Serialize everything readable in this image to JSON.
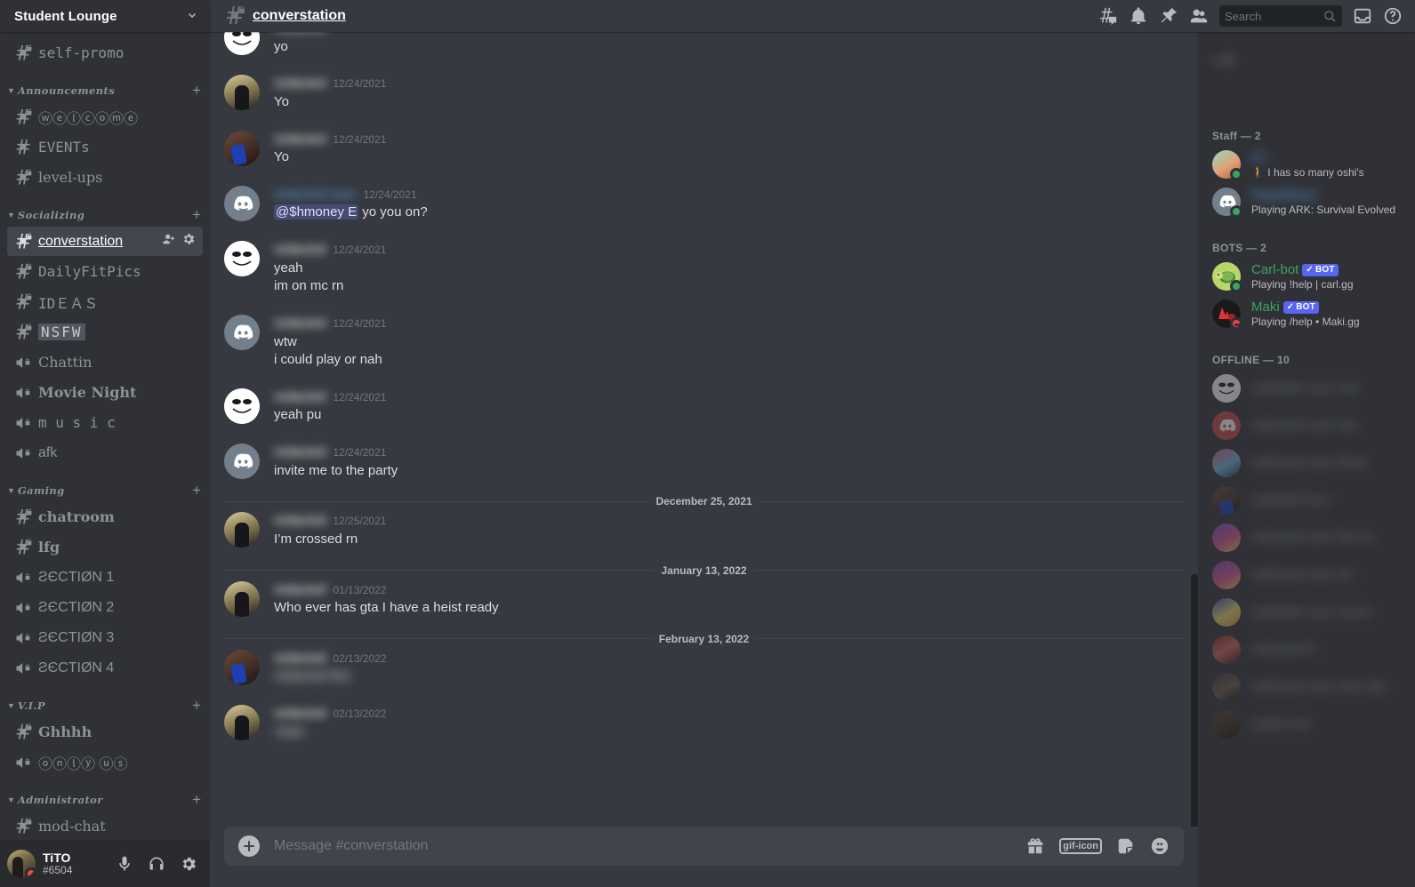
{
  "server": {
    "name": "Student Lounge",
    "chevron": "⌄"
  },
  "sidebar": {
    "top_channel": {
      "label": "self-promo",
      "icon": "hash-lock-icon"
    },
    "categories": [
      {
        "name": "Announcements",
        "channels": [
          {
            "label": "ⓦⓔⓛⓒⓞⓜⓔ",
            "type": "text",
            "locked": true,
            "style": "circled"
          },
          {
            "label": "EVENTs",
            "type": "text",
            "locked": false,
            "style": "plain"
          },
          {
            "label": "level-ups",
            "type": "text",
            "locked": true,
            "style": "serif"
          }
        ]
      },
      {
        "name": "Socializing",
        "channels": [
          {
            "label": "converstation",
            "type": "text",
            "locked": true,
            "style": "plain",
            "active": true
          },
          {
            "label": "DailyFitPics",
            "type": "text",
            "locked": true,
            "style": "mono"
          },
          {
            "label": "IDＥＡＳ",
            "type": "text",
            "locked": true,
            "style": "mono"
          },
          {
            "label": "NSFW",
            "type": "text",
            "locked": true,
            "style": "boxed"
          },
          {
            "label": "Chattin",
            "type": "voice",
            "locked": true,
            "style": "serif"
          },
          {
            "label": "Movie Night",
            "type": "voice",
            "locked": true,
            "style": "gothic"
          },
          {
            "label": "m u s i c",
            "type": "voice",
            "locked": true,
            "style": "mono"
          },
          {
            "label": "afk",
            "type": "voice",
            "locked": true,
            "style": "plain"
          }
        ]
      },
      {
        "name": "Gaming",
        "channels": [
          {
            "label": "chatroom",
            "type": "text",
            "locked": true,
            "style": "gothic"
          },
          {
            "label": "lfg",
            "type": "text",
            "locked": true,
            "style": "gothic"
          },
          {
            "label": "ƧЄCTIØN 1",
            "type": "voice",
            "locked": true,
            "style": "plain"
          },
          {
            "label": "ƧЄCTIØN 2",
            "type": "voice",
            "locked": true,
            "style": "plain"
          },
          {
            "label": "ƧЄCTIØN 3",
            "type": "voice",
            "locked": true,
            "style": "plain"
          },
          {
            "label": "ƧЄCTIØN 4",
            "type": "voice",
            "locked": true,
            "style": "plain"
          }
        ]
      },
      {
        "name": "V.I.P",
        "channels": [
          {
            "label": "Ghhhh",
            "type": "text",
            "locked": true,
            "style": "gothic"
          },
          {
            "label": "ⓞⓝⓛⓨ ⓤⓢ",
            "type": "voice",
            "locked": true,
            "style": "circled"
          }
        ]
      },
      {
        "name": "Administrator",
        "channels": [
          {
            "label": "mod-chat",
            "type": "text",
            "locked": true,
            "style": "serif"
          }
        ]
      }
    ]
  },
  "user_panel": {
    "username": "TiTO",
    "discriminator": "#6504",
    "status": "dnd",
    "icons": [
      "microphone-icon",
      "headphones-icon",
      "gear-icon"
    ]
  },
  "topbar": {
    "channel": "converstation",
    "icons": [
      "threads-icon",
      "bell-icon",
      "pin-icon",
      "members-icon",
      "inbox-icon",
      "help-icon"
    ]
  },
  "search": {
    "placeholder": "Search",
    "value": ""
  },
  "messages": [
    {
      "id": 1,
      "author": "redacted",
      "author_blurred": true,
      "timestamp": "",
      "avatar": "av-meme",
      "lines": [
        {
          "text": "yo"
        }
      ],
      "partial_top": true
    },
    {
      "id": 2,
      "author": "redacted",
      "author_blurred": true,
      "timestamp": "12/24/2021",
      "avatar": "av-suit",
      "lines": [
        {
          "text": "Yo"
        }
      ]
    },
    {
      "id": 3,
      "author": "redacted",
      "author_blurred": true,
      "timestamp": "12/24/2021",
      "avatar": "av-phone",
      "lines": [
        {
          "text": "Yo"
        }
      ]
    },
    {
      "id": 4,
      "author": "redacted-ryan",
      "author_blurred": true,
      "author_color": "blue",
      "timestamp": "12/24/2021",
      "avatar": "av-discord-grey",
      "lines": [
        {
          "mention": "@$hmoney E",
          "text": " yo you on?"
        }
      ]
    },
    {
      "id": 5,
      "author": "redacted",
      "author_blurred": true,
      "timestamp": "12/24/2021",
      "avatar": "av-meme",
      "lines": [
        {
          "text": "yeah"
        },
        {
          "text": "im on mc rn"
        }
      ]
    },
    {
      "id": 6,
      "author": "redacted",
      "author_blurred": true,
      "timestamp": "12/24/2021",
      "avatar": "av-discord-grey",
      "lines": [
        {
          "text": "wtw"
        },
        {
          "text": "i could play or nah"
        }
      ]
    },
    {
      "id": 7,
      "author": "redacted",
      "author_blurred": true,
      "timestamp": "12/24/2021",
      "avatar": "av-meme",
      "lines": [
        {
          "text": "yeah pu"
        }
      ]
    },
    {
      "id": 8,
      "author": "redacted",
      "author_blurred": true,
      "timestamp": "12/24/2021",
      "avatar": "av-discord-grey",
      "lines": [
        {
          "text": "invite me to the party"
        }
      ]
    }
  ],
  "dividers": {
    "dec25": "December 25, 2021",
    "jan13": "January 13, 2022",
    "feb13": "February 13, 2022"
  },
  "messages2": [
    {
      "id": 9,
      "author": "redacted",
      "author_blurred": true,
      "timestamp": "12/25/2021",
      "avatar": "av-suit",
      "lines": [
        {
          "text": "I’m crossed rn"
        }
      ]
    }
  ],
  "messages3": [
    {
      "id": 10,
      "author": "redacted",
      "author_blurred": true,
      "timestamp": "01/13/2022",
      "avatar": "av-suit",
      "lines": [
        {
          "text": "Who ever has gta I have a heist ready"
        }
      ]
    }
  ],
  "messages4": [
    {
      "id": 11,
      "author": "redacted",
      "author_blurred": true,
      "timestamp": "02/13/2022",
      "avatar": "av-phone",
      "lines": [
        {
          "text": "redacted this",
          "blurred": true
        }
      ]
    },
    {
      "id": 12,
      "author": "redacted",
      "author_blurred": true,
      "timestamp": "02/13/2022",
      "avatar": "av-suit",
      "lines": [
        {
          "text": "Yeah",
          "blurred": true
        }
      ]
    }
  ],
  "composer": {
    "placeholder": "Message #converstation",
    "value": "",
    "icons": [
      "gift-icon",
      "gif-icon",
      "sticker-icon",
      "emoji-icon"
    ]
  },
  "members": {
    "groups": [
      {
        "label": "— 1",
        "blurred": true,
        "members": []
      },
      {
        "label": "Staff — 2",
        "blurred": false,
        "members": [
          {
            "name": "EJ",
            "name_blurred": true,
            "name_color": "blue",
            "status": "online",
            "activity": "🚶 I has so many oshi's",
            "avatar": "av-anime1"
          },
          {
            "name": "RapaiRyan",
            "name_blurred": true,
            "name_color": "blue",
            "status": "online",
            "activity": "Playing ARK: Survival Evolved",
            "avatar": "av-discord-grey"
          }
        ]
      },
      {
        "label": "BOTS — 2",
        "blurred": false,
        "members": [
          {
            "name": "Carl-bot",
            "name_blurred": false,
            "name_color": "green",
            "status": "online",
            "bot": true,
            "bot_label": "BOT",
            "activity": "Playing !help | carl.gg",
            "avatar": "av-carl"
          },
          {
            "name": "Maki",
            "name_blurred": false,
            "name_color": "green",
            "status": "dnd",
            "bot": true,
            "bot_label": "BOT",
            "activity": "Playing /help • Maki.gg",
            "avatar": "av-maki"
          }
        ]
      },
      {
        "label": "OFFLINE — 10",
        "blurred": false,
        "offline": true,
        "members": [
          {
            "name": "redacted user one",
            "name_blurred": true,
            "avatar": "av-meme"
          },
          {
            "name": "redacted user two",
            "name_blurred": true,
            "avatar": "av-discord-red"
          },
          {
            "name": "redacted user three",
            "name_blurred": true,
            "avatar": "av-cap"
          },
          {
            "name": "redacted four",
            "name_blurred": true,
            "avatar": "av-phone"
          },
          {
            "name": "redacted user five xx",
            "name_blurred": true,
            "avatar": "av-pinkcat"
          },
          {
            "name": "redacted user six",
            "name_blurred": true,
            "avatar": "av-pinkcat"
          },
          {
            "name": "redacted user seven",
            "name_blurred": true,
            "avatar": "av-bunny"
          },
          {
            "name": "redacted 8",
            "name_blurred": true,
            "avatar": "av-red"
          },
          {
            "name": "redacted user nine abc",
            "name_blurred": true,
            "avatar": "av-dark"
          },
          {
            "name": "redact ten",
            "name_blurred": true,
            "avatar": "av-brown"
          }
        ]
      }
    ]
  },
  "colors": {
    "sidebar_bg": "#2f3136",
    "chat_bg": "#36393f",
    "user_panel_bg": "#292b2f",
    "active_channel_bg": "#42464d",
    "mention_bg": "#464b75",
    "online": "#3ba55d",
    "dnd": "#ed4245",
    "bot_badge": "#5865f2",
    "text_muted": "#8e9297",
    "text_normal": "#dcddde"
  }
}
